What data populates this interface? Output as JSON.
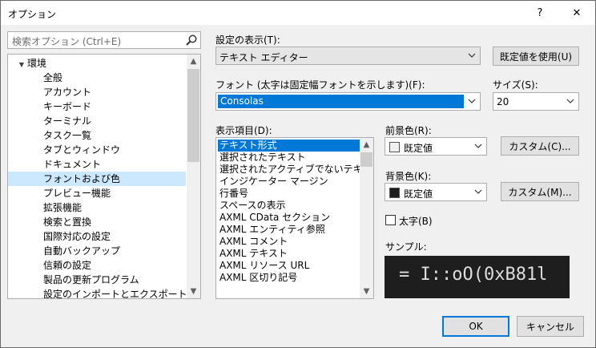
{
  "window": {
    "title": "オプション",
    "help_label": "?",
    "close_label": "✕"
  },
  "search": {
    "placeholder": "検索オプション (Ctrl+E)",
    "icon": "search-icon"
  },
  "tree": {
    "root": "環境",
    "items": [
      "全般",
      "アカウント",
      "キーボード",
      "ターミナル",
      "タスク一覧",
      "タブとウィンドウ",
      "ドキュメント",
      "フォントおよび色",
      "プレビュー機能",
      "拡張機能",
      "検索と置換",
      "国際対応の設定",
      "自動バックアップ",
      "信頼の設定",
      "製品の更新プログラム",
      "設定のインポートとエクスポート"
    ],
    "selected_index": 7
  },
  "show_settings": {
    "label": "設定の表示(T):",
    "value": "テキスト エディター"
  },
  "use_defaults_label": "既定値を使用(U)",
  "font": {
    "label": "フォント (太字は固定幅フォントを示します)(F):",
    "value": "Consolas"
  },
  "size": {
    "label": "サイズ(S):",
    "value": "20"
  },
  "display_items": {
    "label": "表示項目(D):",
    "items": [
      "テキスト形式",
      "選択されたテキスト",
      "選択されたアクティブでないテキスト",
      "インジケーター マージン",
      "行番号",
      "スペースの表示",
      "AXML CData セクション",
      "AXML エンティティ参照",
      "AXML コメント",
      "AXML テキスト",
      "AXML リソース URL",
      "AXML 区切り記号"
    ],
    "selected_index": 0
  },
  "foreground": {
    "label": "前景色(R):",
    "value": "既定値",
    "swatch_color": "#f0f0f0",
    "custom_label": "カスタム(C)..."
  },
  "background": {
    "label": "背景色(K):",
    "value": "既定値",
    "swatch_color": "#1e1e1e",
    "custom_label": "カスタム(M)..."
  },
  "bold": {
    "label": "太字(B)",
    "checked": false
  },
  "sample": {
    "label": "サンプル:",
    "text": "= I::oO(0xB81l"
  },
  "ok_label": "OK",
  "cancel_label": "キャンセル",
  "colors": {
    "accent": "#0078d7",
    "selection_light": "#cce8ff",
    "sample_bg": "#1e1e1e"
  }
}
